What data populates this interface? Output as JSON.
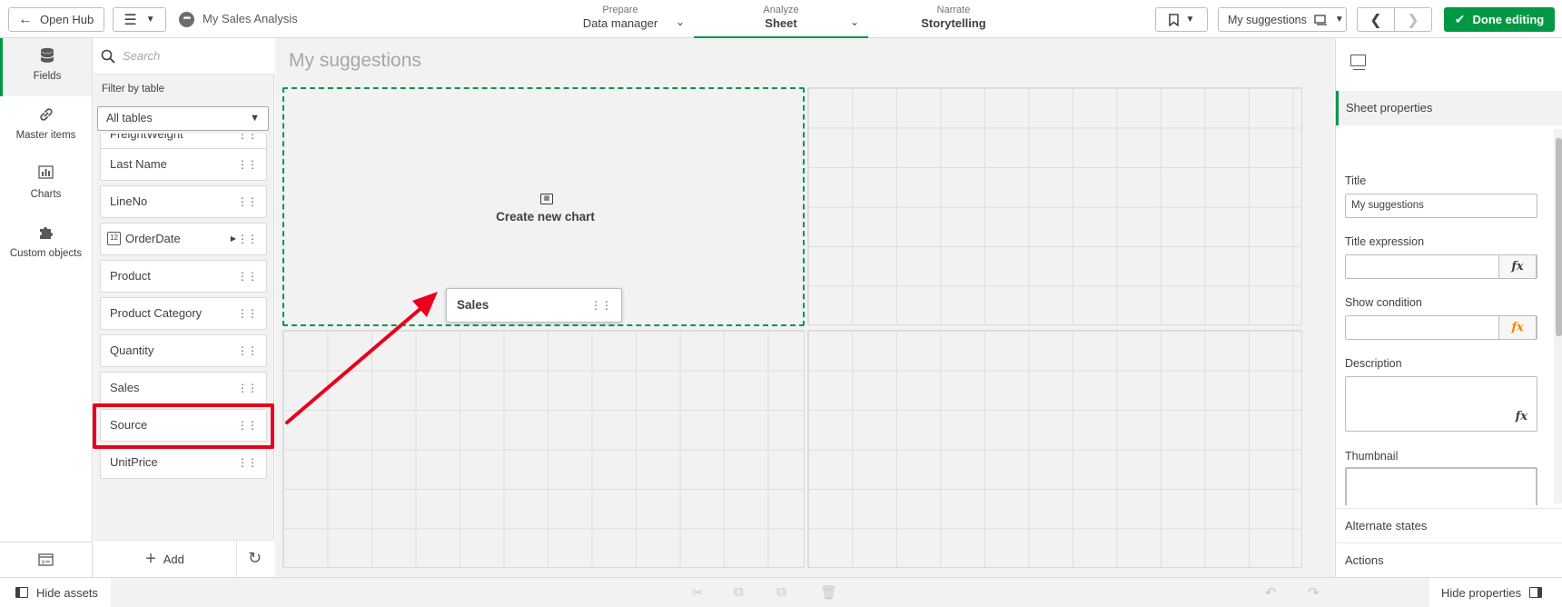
{
  "header": {
    "open_hub_label": "Open Hub",
    "app_name": "My Sales Analysis",
    "app_icon": "ellipsis-circle-icon",
    "tabs": [
      {
        "small": "Prepare",
        "big": "Data manager"
      },
      {
        "small": "Analyze",
        "big": "Sheet"
      },
      {
        "small": "Narrate",
        "big": "Storytelling"
      }
    ],
    "sheet_selector_label": "My suggestions",
    "done_label": "Done editing",
    "accent_color": "#009845"
  },
  "rail": {
    "items": [
      {
        "label": "Fields",
        "icon": "database-icon"
      },
      {
        "label": "Master items",
        "icon": "link-icon"
      },
      {
        "label": "Charts",
        "icon": "bar-chart-icon"
      },
      {
        "label": "Custom objects",
        "icon": "puzzle-icon"
      }
    ]
  },
  "fields_panel": {
    "search_placeholder": "Search",
    "filter_label": "Filter by table",
    "table_select_value": "All tables",
    "fields": [
      {
        "name": "FreightWeight"
      },
      {
        "name": "Last Name"
      },
      {
        "name": "LineNo"
      },
      {
        "name": "OrderDate"
      },
      {
        "name": "Product"
      },
      {
        "name": "Product Category"
      },
      {
        "name": "Quantity"
      },
      {
        "name": "Sales"
      },
      {
        "name": "Source"
      },
      {
        "name": "UnitPrice"
      }
    ],
    "highlighted_field": "Sales",
    "add_label": "Add"
  },
  "canvas": {
    "sheet_title": "My suggestions",
    "drop_zone_text": "Create new chart",
    "dragged_field": "Sales",
    "highlight_color": "#e8001c"
  },
  "properties": {
    "tab_label": "Sheet properties",
    "title_label": "Title",
    "title_value": "My suggestions",
    "title_expression_label": "Title expression",
    "show_condition_label": "Show condition",
    "description_label": "Description",
    "thumbnail_label": "Thumbnail",
    "alternate_states_label": "Alternate states",
    "actions_label": "Actions"
  },
  "footer": {
    "hide_assets_label": "Hide assets",
    "hide_properties_label": "Hide properties"
  }
}
